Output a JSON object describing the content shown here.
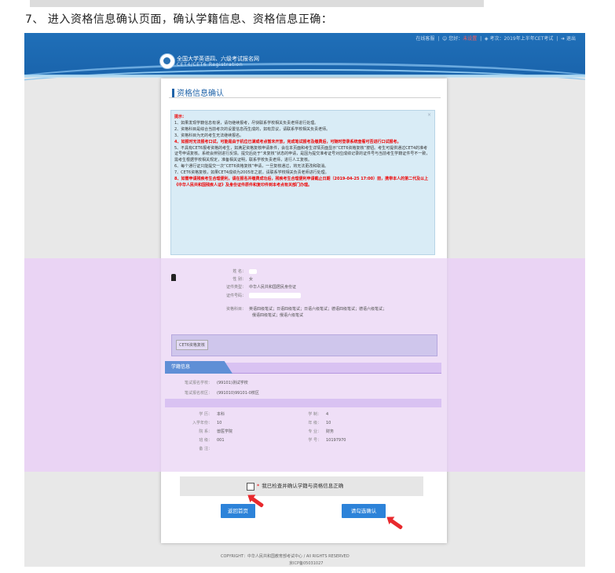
{
  "step": "7、 进入资格信息确认页面，确认学籍信息、资格信息正确：",
  "topbar": {
    "online_help": "在线客服",
    "greeting_prefix": "您好：",
    "greeting_status": "未设置",
    "exam_label": "考次：2019年上半年CET考试",
    "logout": "退出"
  },
  "logo": {
    "line1": "全国大学英语四、六级考试报名网",
    "line2": "CET4/CET6  Registration"
  },
  "page_title": "资格信息确认",
  "notice": {
    "heading": "提示：",
    "lines": [
      "1、如果发现学籍信息有误，请勿继续报考，尽快联系学校相关负责老师进行处理。",
      "2、资格科目是综合当前考次的设置信息而生成的，如有异议，请联系学校相关负责老师。",
      "3、资格科目为无的考生无法继续报名。",
      "4、如报时无法报考口试，可能是由于机位已满或考点暂未开放，完成笔试报考及缴费后，可随时登录系统查看可否进行口试报考。",
      "5、不具有CET6报考资格的考生，如满足资格复核申请条件，会在本页面和考生详情页面显示“CET6资格复核”按钮。考生可提供通过CET4的准考证号申请复核。系统会辨别进行反馈。提交后处于“未复核”状态的申请，是因为提交准考证号对应成绩记录的证件号与当前考生学籍证件号不一致，需考生根据学校相关规定，准备相关证明，联系学校负责老师，进行人工复核。",
      "6、每个通行证只能提交一次“CET6资格复核”申请，一旦复核通过，将无法更改和取消。",
      "7、CET6资格复核，如果CET4成绩为2005年之前，请联系学校相关负责老师进行处理。",
      "8、如需申请残疾考生合理便利，请在报名并缴费成功后，残疾考生合理便利申请截止日期（2019-04-25 17:00）前，携带本人的第二代及以上《中华人民共和国残疾人证》及身份证件原件和复印件到本考点有关部门办理。"
    ]
  },
  "personal": {
    "name_label": "姓    名：",
    "gender_label": "性    别：",
    "gender": "女",
    "idtype_label": "证件类型：",
    "idtype": "中华人民共和国居民身份证",
    "idnum_label": "证件号码：",
    "subjects_label": "资格科目：",
    "subjects_line1": "英语四级笔试；日语四级笔试；日语六级笔试；德语四级笔试；德语六级笔试；",
    "subjects_line2": "俄语四级笔试；俄语六级笔试"
  },
  "review_button": "CET6资格复核",
  "xueji": {
    "tab": "学籍信息",
    "school_label": "笔试报名学校：",
    "school": "(99101)测试学校",
    "campus_label": "笔试报名校区：",
    "campus": "(991010)99101-0校区",
    "rows": [
      {
        "l1": "学    历：",
        "v1": "本科",
        "l2": "学    制：",
        "v2": "4"
      },
      {
        "l1": "入学年份：",
        "v1": "10",
        "l2": "年    级：",
        "v2": "10"
      },
      {
        "l1": "院    系：",
        "v1": "兽医学院",
        "l2": "专    业：",
        "v2": "财务"
      },
      {
        "l1": "班    级：",
        "v1": "001",
        "l2": "学    号：",
        "v2": "10197970"
      },
      {
        "l1": "备    注：",
        "v1": "",
        "l2": "",
        "v2": ""
      }
    ]
  },
  "agree": {
    "star": "*",
    "text": "我已检查并确认学籍与资格信息正确"
  },
  "buttons": {
    "back": "返回首页",
    "confirm": "请勾选确认"
  },
  "footer": {
    "copyright": "COPYRIGHT：中华人民共和国教育部考试中心 / All RIGHTS RESERVED",
    "icp": "京ICP备05031027"
  },
  "colors": {
    "header_blue": "#1f6fb8",
    "purple_bg": "#e9d4f4",
    "button_blue": "#2d83d9",
    "alert_red": "#e8292d"
  }
}
